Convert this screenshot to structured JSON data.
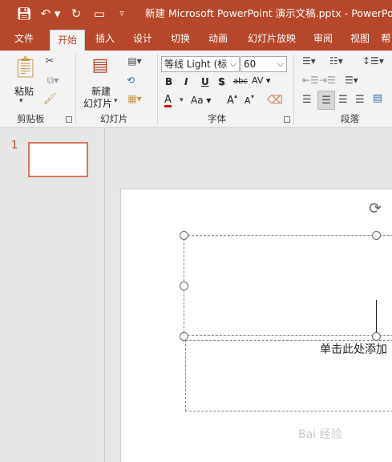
{
  "window": {
    "title": "新建 Microsoft PowerPoint 演示文稿.pptx  -  PowerPo",
    "quick_access": [
      "save-icon",
      "undo-icon",
      "redo-icon",
      "presentation-icon",
      "customize-icon"
    ]
  },
  "tabs": [
    "文件",
    "开始",
    "插入",
    "设计",
    "切换",
    "动画",
    "幻灯片放映",
    "审阅",
    "视图",
    "帮"
  ],
  "active_tab": "开始",
  "ribbon": {
    "clipboard": {
      "paste_label": "粘贴",
      "group_label": "剪贴板"
    },
    "slides": {
      "new_slide_line1": "新建",
      "new_slide_line2": "幻灯片",
      "group_label": "幻灯片"
    },
    "font": {
      "font_name": "等线 Light (标",
      "font_size": "60",
      "bold": "B",
      "italic": "I",
      "underline": "U",
      "shadow": "S",
      "strikethrough": "abc",
      "spacing": "AV",
      "font_color": "A",
      "change_case": "Aa",
      "grow": "A",
      "shrink": "A",
      "group_label": "字体"
    },
    "paragraph": {
      "group_label": "段落"
    }
  },
  "thumbnail": {
    "number": "1"
  },
  "slide": {
    "subtitle_text": "单击此处添加"
  },
  "watermark": "Bai 经验",
  "colors": {
    "accent": "#b7472a",
    "thumb_border": "#d9765a"
  }
}
